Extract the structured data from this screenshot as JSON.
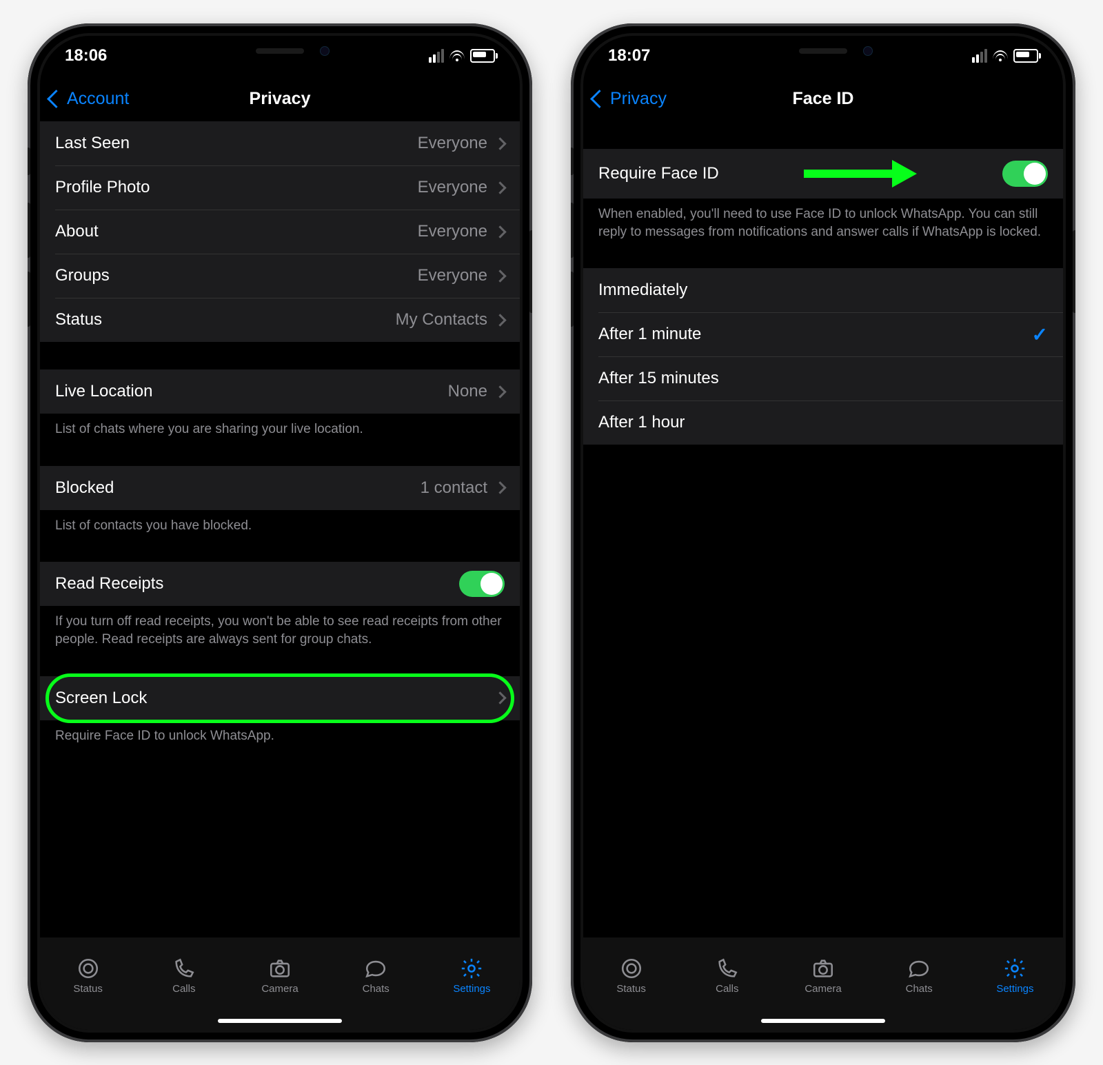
{
  "phones": [
    {
      "statusbar": {
        "time": "18:06"
      },
      "nav": {
        "back_label": "Account",
        "title": "Privacy"
      },
      "privacy": {
        "rows": [
          {
            "label": "Last Seen",
            "value": "Everyone"
          },
          {
            "label": "Profile Photo",
            "value": "Everyone"
          },
          {
            "label": "About",
            "value": "Everyone"
          },
          {
            "label": "Groups",
            "value": "Everyone"
          },
          {
            "label": "Status",
            "value": "My Contacts"
          }
        ],
        "live_location": {
          "label": "Live Location",
          "value": "None",
          "note": "List of chats where you are sharing your live location."
        },
        "blocked": {
          "label": "Blocked",
          "value": "1 contact",
          "note": "List of contacts you have blocked."
        },
        "read_receipts": {
          "label": "Read Receipts",
          "enabled": true,
          "note": "If you turn off read receipts, you won't be able to see read receipts from other people. Read receipts are always sent for group chats."
        },
        "screen_lock": {
          "label": "Screen Lock",
          "note": "Require Face ID to unlock WhatsApp."
        }
      }
    },
    {
      "statusbar": {
        "time": "18:07"
      },
      "nav": {
        "back_label": "Privacy",
        "title": "Face ID"
      },
      "faceid": {
        "require_label": "Require Face ID",
        "require_enabled": true,
        "require_note": "When enabled, you'll need to use Face ID to unlock WhatsApp. You can still reply to messages from notifications and answer calls if WhatsApp is locked.",
        "timeouts": [
          "Immediately",
          "After 1 minute",
          "After 15 minutes",
          "After 1 hour"
        ],
        "selected_index": 1
      }
    }
  ],
  "tabs": [
    {
      "name": "Status",
      "icon": "status-icon"
    },
    {
      "name": "Calls",
      "icon": "phone-icon"
    },
    {
      "name": "Camera",
      "icon": "camera-icon"
    },
    {
      "name": "Chats",
      "icon": "chat-icon"
    },
    {
      "name": "Settings",
      "icon": "gear-icon"
    }
  ],
  "active_tab_index": 4
}
